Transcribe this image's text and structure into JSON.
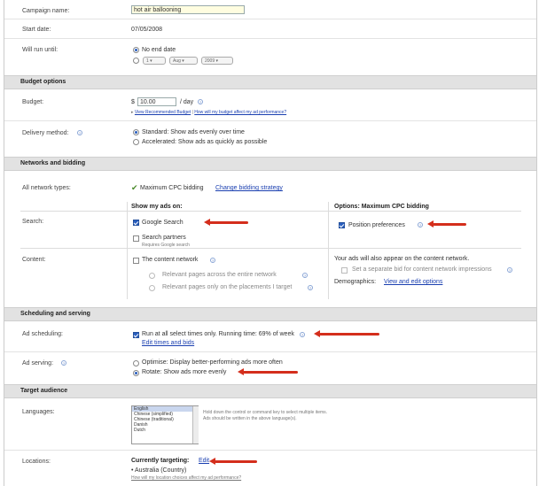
{
  "campaign": {
    "name_label": "Campaign name:",
    "name_value": "hot air ballooning",
    "start_label": "Start date:",
    "start_value": "07/05/2008",
    "run_label": "Will run until:",
    "no_end_label": "No end date",
    "end_day": "1",
    "end_month": "Aug",
    "end_year": "2009"
  },
  "budget": {
    "section_title": "Budget options",
    "budget_label": "Budget:",
    "currency": "$",
    "amount": "10.00",
    "per_day": "/ day",
    "view_link": "View Recommended Budget",
    "sep": " | ",
    "affect_link": "How will my budget affect my ad performance?",
    "delivery_label": "Delivery method:",
    "standard": "Standard: Show ads evenly over time",
    "accelerated": "Accelerated: Show ads as quickly as possible"
  },
  "networks": {
    "section_title": "Networks and bidding",
    "all_label": "All network types:",
    "bidding": "Maximum CPC bidding",
    "change_link": "Change bidding strategy",
    "col_show": "Show my ads on:",
    "col_options": "Options: Maximum CPC bidding",
    "search_label": "Search:",
    "google_search": "Google Search",
    "search_partners": "Search partners",
    "requires": "Requires Google search",
    "position_pref": "Position preferences",
    "content_label": "Content:",
    "content_network": "The content network",
    "relevant_entire": "Relevant pages across the entire network",
    "relevant_placements": "Relevant pages only on the placements I target",
    "ads_appear": "Your ads will also appear on the content network.",
    "separate_bid": "Set a separate bid for content network impressions",
    "demographics": "Demographics:",
    "view_edit": "View and edit options"
  },
  "scheduling": {
    "section_title": "Scheduling and serving",
    "ad_sched_label": "Ad scheduling:",
    "run_all": "Run at all select times only. Running time: 69% of week",
    "edit_times": "Edit times and bids",
    "serving_label": "Ad serving:",
    "optimise": "Optimise: Display better-performing ads more often",
    "rotate": "Rotate: Show ads more evenly"
  },
  "audience": {
    "section_title": "Target audience",
    "languages_label": "Languages:",
    "languages": [
      "English",
      "Chinese (simplified)",
      "Chinese (traditional)",
      "Danish",
      "Dutch"
    ],
    "hint": "Hold down the control or command key to select multiple items.",
    "hint2": "Ads should be written in the above language(s).",
    "locations_label": "Locations:",
    "currently": "Currently targeting:",
    "edit": "Edit",
    "location": "• Australia (Country)",
    "loc_link": "How will my location choices affect my ad performance?"
  },
  "colors": {
    "accent": "#1a3fb0",
    "arrow": "#d42e1c",
    "section_bg": "#e2e2e2"
  }
}
